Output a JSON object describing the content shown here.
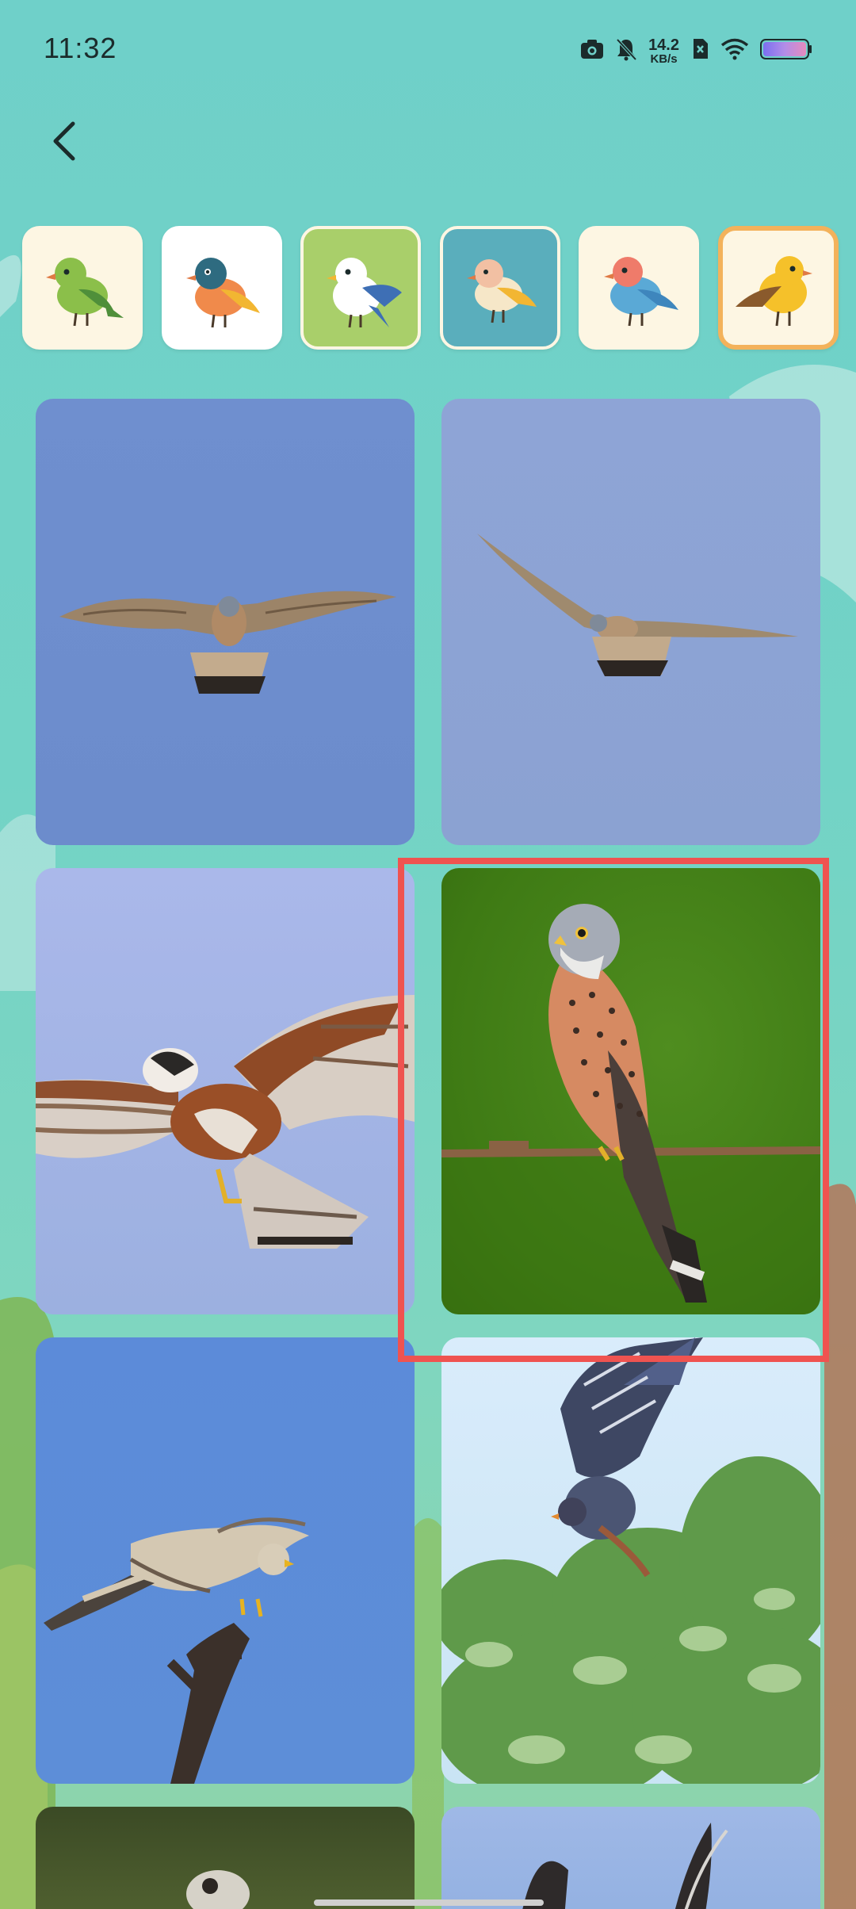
{
  "status_bar": {
    "time": "11:32",
    "net_speed_value": "14.2",
    "net_speed_unit": "KB/s",
    "icons": [
      "camera-icon",
      "bell-muted-icon",
      "sim-x-icon",
      "wifi-icon",
      "battery-icon"
    ]
  },
  "nav": {
    "back_icon": "chevron-left-icon"
  },
  "bird_selector": {
    "items": [
      {
        "name": "green-bird",
        "body": "#8bbf4a",
        "wing": "#4f8f3a",
        "head": "#8bbf4a",
        "beak": "#e07a45"
      },
      {
        "name": "blue-orange-bird",
        "body": "#f08a4b",
        "wing": "#f2b632",
        "head": "#2e6b80",
        "beak": "#e07a45"
      },
      {
        "name": "white-blue-bird",
        "body": "#ffffff",
        "wing": "#3e6fb5",
        "head": "#ffffff",
        "beak": "#f2b632"
      },
      {
        "name": "cream-yellow-bird",
        "body": "#f6e7c8",
        "wing": "#f2b632",
        "head": "#f2c0a3",
        "beak": "#e07a45"
      },
      {
        "name": "blue-pink-bird",
        "body": "#5aa9d6",
        "wing": "#3e86bd",
        "head": "#ef7b6a",
        "beak": "#e07a45"
      },
      {
        "name": "yellow-brown-bird",
        "body": "#f5c12a",
        "wing": "#8a5a2c",
        "head": "#f5c12a",
        "beak": "#e07a45"
      }
    ],
    "selected_index": 5
  },
  "photos": [
    {
      "name": "kestrel-hovering-photo"
    },
    {
      "name": "kestrel-gliding-photo"
    },
    {
      "name": "kestrel-flight-closeup-photo"
    },
    {
      "name": "kestrel-perched-photo"
    },
    {
      "name": "kestrel-on-branch-photo"
    },
    {
      "name": "kestrel-in-tree-photo"
    },
    {
      "name": "partial-photo-bottom-left"
    },
    {
      "name": "partial-photo-bottom-right"
    }
  ]
}
